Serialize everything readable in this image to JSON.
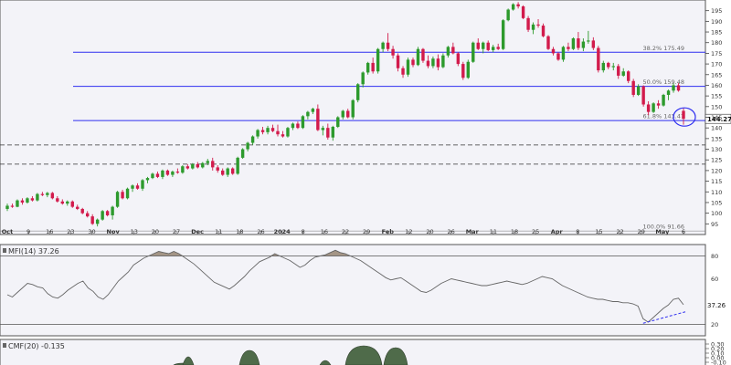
{
  "chart_data": {
    "type": "candlestick",
    "title": "",
    "price_panel": {
      "ylim": [
        90,
        200
      ],
      "y_ticks": [
        95,
        100,
        105,
        110,
        115,
        120,
        125,
        130,
        135,
        140,
        145,
        150,
        155,
        160,
        165,
        170,
        175,
        180,
        185,
        190,
        195
      ],
      "last_price_label": "144.27",
      "fibonacci": [
        {
          "label": "38.2% 175.49",
          "value": 175.49
        },
        {
          "label": "50.0% 159.48",
          "value": 159.48
        },
        {
          "label": "61.8% 143.47",
          "value": 143.47
        },
        {
          "label": "100.0% 91.66",
          "value": 91.66
        }
      ],
      "dashed_levels": [
        132,
        123
      ],
      "candles": [
        [
          102.0,
          104.5,
          101.0,
          103.5
        ],
        [
          103.5,
          104.5,
          102.5,
          103.0
        ],
        [
          103.0,
          106.5,
          102.8,
          106.0
        ],
        [
          106.0,
          107.0,
          104.0,
          105.0
        ],
        [
          105.0,
          107.5,
          104.5,
          107.0
        ],
        [
          107.0,
          108.0,
          105.5,
          106.0
        ],
        [
          106.0,
          109.5,
          105.5,
          109.0
        ],
        [
          109.0,
          110.0,
          108.0,
          108.5
        ],
        [
          108.5,
          110.0,
          107.5,
          109.5
        ],
        [
          109.5,
          110.0,
          106.5,
          107.0
        ],
        [
          107.0,
          108.0,
          105.0,
          105.5
        ],
        [
          105.5,
          106.5,
          104.0,
          104.5
        ],
        [
          104.5,
          106.0,
          103.5,
          105.5
        ],
        [
          105.5,
          106.0,
          102.5,
          103.0
        ],
        [
          103.0,
          104.0,
          101.5,
          102.0
        ],
        [
          102.0,
          102.5,
          99.5,
          100.0
        ],
        [
          100.0,
          101.0,
          98.0,
          98.5
        ],
        [
          98.5,
          99.5,
          94.5,
          95.0
        ],
        [
          95.0,
          97.5,
          93.8,
          97.0
        ],
        [
          97.0,
          101.5,
          96.5,
          101.0
        ],
        [
          101.0,
          101.5,
          98.5,
          99.0
        ],
        [
          99.0,
          103.5,
          97.0,
          103.0
        ],
        [
          103.0,
          110.5,
          102.5,
          110.0
        ],
        [
          110.0,
          111.0,
          106.5,
          107.0
        ],
        [
          107.0,
          112.0,
          106.5,
          111.5
        ],
        [
          111.5,
          113.5,
          110.0,
          113.0
        ],
        [
          113.0,
          114.0,
          111.0,
          111.5
        ],
        [
          111.5,
          116.0,
          110.5,
          115.5
        ],
        [
          115.5,
          117.0,
          114.0,
          116.5
        ],
        [
          116.5,
          119.0,
          116.0,
          118.5
        ],
        [
          118.5,
          119.5,
          116.5,
          117.0
        ],
        [
          117.0,
          120.5,
          116.0,
          120.0
        ],
        [
          120.0,
          120.5,
          117.5,
          118.0
        ],
        [
          118.0,
          120.0,
          117.0,
          119.5
        ],
        [
          119.5,
          121.0,
          118.5,
          119.0
        ],
        [
          119.0,
          122.5,
          118.5,
          122.0
        ],
        [
          122.0,
          123.0,
          120.5,
          121.0
        ],
        [
          121.0,
          123.5,
          120.5,
          123.0
        ],
        [
          123.0,
          124.0,
          121.0,
          121.5
        ],
        [
          121.5,
          124.0,
          121.0,
          123.5
        ],
        [
          123.5,
          125.5,
          122.5,
          124.5
        ],
        [
          124.5,
          126.0,
          120.0,
          121.5
        ],
        [
          121.5,
          122.5,
          119.0,
          120.0
        ],
        [
          120.0,
          121.0,
          117.5,
          118.0
        ],
        [
          118.0,
          121.5,
          117.0,
          121.0
        ],
        [
          121.0,
          121.5,
          118.0,
          118.5
        ],
        [
          118.5,
          126.5,
          118.0,
          126.0
        ],
        [
          126.0,
          130.5,
          125.5,
          130.0
        ],
        [
          130.0,
          133.5,
          129.0,
          133.0
        ],
        [
          133.0,
          136.5,
          132.0,
          136.0
        ],
        [
          136.0,
          139.5,
          135.0,
          139.0
        ],
        [
          139.0,
          140.5,
          137.0,
          138.0
        ],
        [
          138.0,
          141.0,
          137.0,
          140.0
        ],
        [
          140.0,
          141.5,
          138.0,
          138.5
        ],
        [
          138.5,
          141.5,
          136.0,
          137.0
        ],
        [
          137.0,
          138.5,
          135.5,
          136.0
        ],
        [
          136.0,
          140.5,
          135.5,
          140.0
        ],
        [
          140.0,
          142.5,
          139.0,
          142.0
        ],
        [
          142.0,
          143.0,
          139.5,
          140.0
        ],
        [
          140.0,
          146.0,
          139.5,
          145.5
        ],
        [
          145.5,
          148.0,
          144.0,
          147.5
        ],
        [
          147.5,
          149.5,
          146.5,
          149.0
        ],
        [
          149.0,
          151.0,
          138.5,
          139.0
        ],
        [
          139.0,
          141.0,
          136.5,
          140.0
        ],
        [
          140.0,
          142.0,
          134.5,
          135.5
        ],
        [
          135.5,
          141.0,
          134.0,
          140.5
        ],
        [
          140.5,
          145.5,
          140.0,
          145.0
        ],
        [
          145.0,
          148.5,
          144.0,
          148.0
        ],
        [
          148.0,
          149.0,
          144.5,
          145.0
        ],
        [
          145.0,
          153.5,
          144.0,
          153.0
        ],
        [
          153.0,
          161.0,
          152.0,
          160.5
        ],
        [
          160.5,
          166.5,
          159.0,
          166.0
        ],
        [
          166.0,
          171.0,
          165.0,
          170.5
        ],
        [
          170.5,
          173.0,
          165.5,
          166.5
        ],
        [
          166.5,
          177.5,
          165.5,
          177.0
        ],
        [
          177.0,
          180.5,
          175.5,
          180.0
        ],
        [
          180.0,
          184.5,
          176.0,
          177.0
        ],
        [
          177.0,
          178.5,
          172.5,
          174.0
        ],
        [
          174.0,
          175.0,
          166.5,
          168.0
        ],
        [
          168.0,
          169.0,
          163.5,
          165.0
        ],
        [
          165.0,
          173.0,
          164.0,
          172.0
        ],
        [
          172.0,
          173.0,
          168.5,
          169.5
        ],
        [
          169.5,
          178.0,
          169.0,
          177.0
        ],
        [
          177.0,
          177.5,
          170.5,
          171.5
        ],
        [
          171.5,
          174.0,
          168.0,
          169.0
        ],
        [
          169.0,
          173.5,
          168.0,
          172.5
        ],
        [
          172.5,
          174.5,
          167.0,
          168.5
        ],
        [
          168.5,
          175.0,
          168.0,
          174.0
        ],
        [
          174.0,
          178.5,
          173.0,
          178.0
        ],
        [
          178.0,
          180.0,
          174.5,
          175.0
        ],
        [
          175.0,
          175.5,
          169.0,
          170.0
        ],
        [
          170.0,
          171.0,
          162.5,
          163.5
        ],
        [
          163.5,
          172.0,
          163.0,
          171.0
        ],
        [
          171.0,
          180.5,
          170.5,
          180.0
        ],
        [
          180.0,
          182.0,
          176.5,
          177.0
        ],
        [
          177.0,
          180.5,
          175.0,
          180.0
        ],
        [
          180.0,
          181.0,
          176.0,
          176.5
        ],
        [
          176.5,
          179.0,
          175.5,
          178.0
        ],
        [
          178.0,
          179.5,
          176.5,
          177.0
        ],
        [
          177.0,
          191.0,
          176.5,
          190.5
        ],
        [
          190.5,
          196.0,
          190.0,
          195.5
        ],
        [
          195.5,
          198.5,
          195.0,
          198.0
        ],
        [
          198.0,
          199.0,
          196.0,
          197.0
        ],
        [
          197.0,
          197.5,
          191.0,
          191.5
        ],
        [
          191.5,
          192.5,
          185.0,
          186.0
        ],
        [
          186.0,
          189.5,
          184.0,
          188.5
        ],
        [
          188.5,
          191.0,
          187.0,
          188.0
        ],
        [
          188.0,
          189.0,
          182.5,
          183.0
        ],
        [
          183.0,
          183.5,
          176.5,
          177.0
        ],
        [
          177.0,
          178.0,
          174.0,
          175.0
        ],
        [
          175.0,
          175.5,
          171.5,
          172.0
        ],
        [
          172.0,
          178.5,
          171.0,
          178.0
        ],
        [
          178.0,
          180.0,
          176.0,
          177.0
        ],
        [
          177.0,
          182.5,
          176.5,
          182.0
        ],
        [
          182.0,
          185.0,
          176.5,
          177.5
        ],
        [
          177.5,
          182.0,
          176.0,
          180.5
        ],
        [
          180.5,
          185.5,
          179.5,
          181.0
        ],
        [
          181.0,
          182.5,
          176.5,
          177.5
        ],
        [
          177.5,
          178.5,
          166.0,
          167.0
        ],
        [
          167.0,
          171.5,
          166.0,
          170.5
        ],
        [
          170.5,
          171.0,
          167.5,
          168.5
        ],
        [
          168.5,
          170.5,
          167.0,
          169.0
        ],
        [
          169.0,
          170.0,
          163.0,
          164.5
        ],
        [
          164.5,
          168.0,
          164.0,
          166.5
        ],
        [
          166.5,
          167.0,
          161.0,
          162.0
        ],
        [
          162.0,
          163.0,
          154.5,
          155.5
        ],
        [
          155.5,
          160.5,
          155.0,
          159.5
        ],
        [
          159.5,
          160.0,
          150.0,
          151.0
        ],
        [
          151.0,
          152.5,
          146.0,
          147.5
        ],
        [
          147.5,
          152.0,
          147.0,
          151.5
        ],
        [
          151.5,
          153.0,
          149.0,
          150.5
        ],
        [
          150.5,
          156.0,
          150.0,
          155.5
        ],
        [
          155.5,
          158.0,
          153.0,
          157.5
        ],
        [
          157.5,
          161.0,
          156.5,
          160.0
        ],
        [
          160.0,
          161.0,
          157.0,
          157.5
        ],
        [
          148.0,
          149.5,
          141.5,
          144.27
        ]
      ]
    },
    "x_axis": {
      "labels": [
        "Oct",
        "9",
        "16",
        "23",
        "30",
        "Nov",
        "13",
        "20",
        "27",
        "Dec",
        "11",
        "18",
        "26",
        "2024",
        "8",
        "16",
        "22",
        "29",
        "Feb",
        "12",
        "20",
        "26",
        "Mar",
        "11",
        "18",
        "25",
        "Apr",
        "8",
        "15",
        "22",
        "29",
        "May",
        "6"
      ],
      "bold_labels": [
        "Oct",
        "Nov",
        "Dec",
        "2024",
        "Feb",
        "Mar",
        "Apr",
        "May"
      ]
    },
    "mfi_panel": {
      "title": "MFI(14) 37.26",
      "ylim": [
        10,
        90
      ],
      "ref_lines": [
        80,
        20
      ],
      "y_ticks": [
        20,
        40,
        60,
        80
      ],
      "last_value_label": "37.26",
      "values": [
        46,
        44,
        48,
        52,
        56,
        55,
        53,
        52,
        47,
        44,
        43,
        46,
        50,
        53,
        56,
        58,
        52,
        49,
        44,
        42,
        46,
        52,
        58,
        62,
        66,
        72,
        75,
        78,
        80,
        82,
        84,
        83,
        82,
        84,
        82,
        79,
        76,
        73,
        69,
        65,
        61,
        57,
        55,
        53,
        51,
        54,
        58,
        62,
        67,
        71,
        75,
        77,
        79,
        82,
        80,
        78,
        76,
        73,
        70,
        72,
        76,
        79,
        80,
        81,
        83,
        85,
        83,
        82,
        80,
        78,
        76,
        73,
        70,
        67,
        64,
        61,
        59,
        60,
        61,
        58,
        55,
        52,
        49,
        48,
        50,
        53,
        56,
        58,
        60,
        59,
        58,
        57,
        56,
        55,
        54,
        54,
        55,
        56,
        57,
        58,
        57,
        56,
        55,
        56,
        58,
        60,
        62,
        61,
        60,
        57,
        54,
        52,
        50,
        48,
        46,
        44,
        43,
        42,
        42,
        41,
        40,
        40,
        39,
        39,
        38,
        36,
        25,
        22,
        26,
        30,
        34,
        37,
        42,
        43,
        37.26
      ]
    },
    "cmf_panel": {
      "title": "CMF(20) -0.135",
      "ylim": [
        -0.4,
        0.4
      ],
      "y_ticks": [
        0.3,
        0.2,
        0.1,
        0.0,
        -0.1,
        -0.2,
        -0.3
      ],
      "y_tick_labels": [
        "0.30",
        "0.20",
        "0.10",
        "0.00",
        "-0.10",
        "-0.20",
        "-0.30"
      ]
    },
    "colors": {
      "up": "#2d9a2d",
      "down": "#d21b4c",
      "fib_line": "#2e2ef0",
      "indicator": "#888888",
      "fill_area": "#8a7560",
      "cmf_fill": "#4f6b4a",
      "circle": "#2e2ef0"
    }
  }
}
